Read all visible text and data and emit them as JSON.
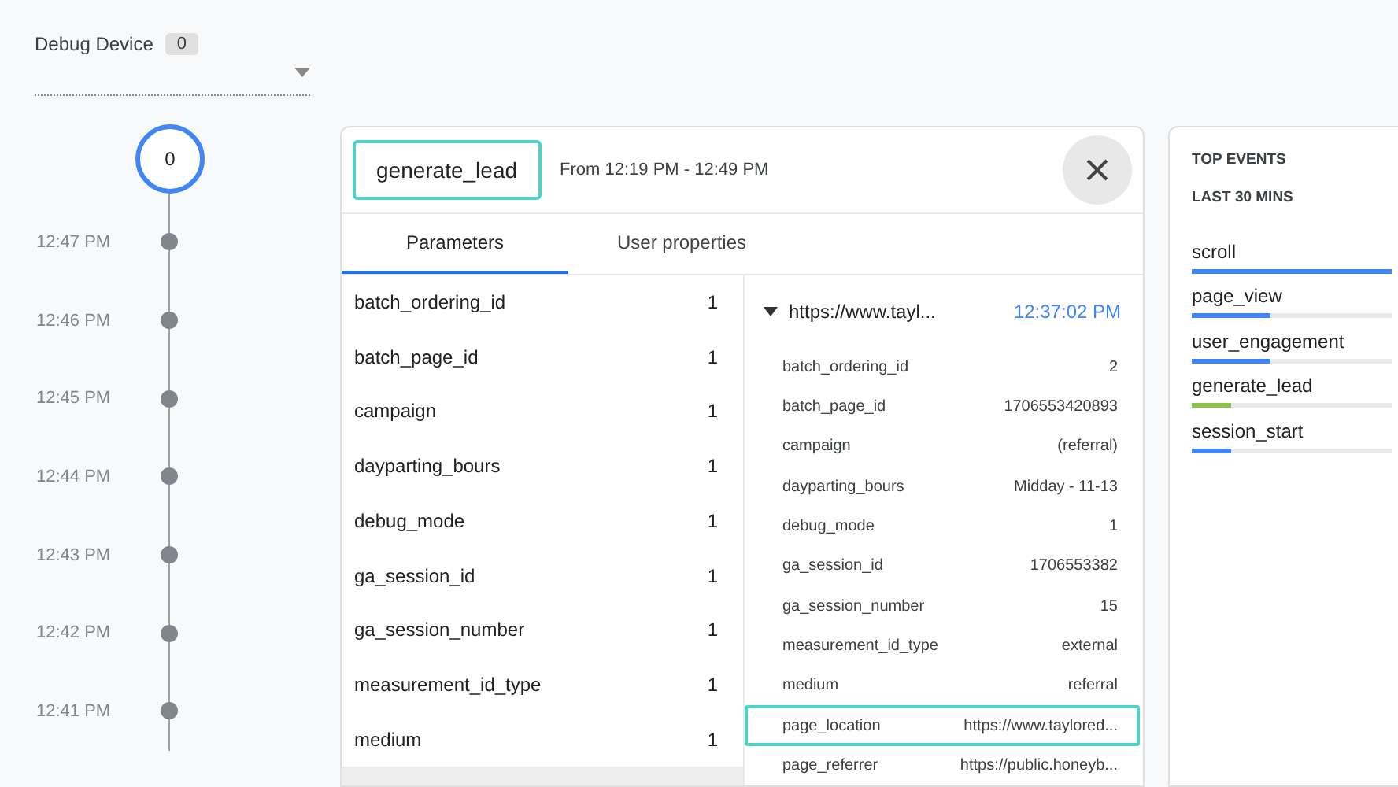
{
  "debug_device": {
    "label": "Debug Device",
    "count": "0"
  },
  "timeline": {
    "event_count": "0",
    "ticks": [
      "12:47 PM",
      "12:46 PM",
      "12:45 PM",
      "12:44 PM",
      "12:43 PM",
      "12:42 PM",
      "12:41 PM"
    ]
  },
  "event_panel": {
    "event_name": "generate_lead",
    "event_highlighted": true,
    "range": "From 12:19 PM - 12:49 PM",
    "tabs": [
      {
        "label": "Parameters",
        "selected": true
      },
      {
        "label": "User properties",
        "selected": false
      }
    ],
    "parameters": [
      {
        "name": "batch_ordering_id",
        "count": "1"
      },
      {
        "name": "batch_page_id",
        "count": "1"
      },
      {
        "name": "campaign",
        "count": "1"
      },
      {
        "name": "dayparting_bours",
        "count": "1"
      },
      {
        "name": "debug_mode",
        "count": "1"
      },
      {
        "name": "ga_session_id",
        "count": "1"
      },
      {
        "name": "ga_session_number",
        "count": "1"
      },
      {
        "name": "measurement_id_type",
        "count": "1"
      },
      {
        "name": "medium",
        "count": "1"
      }
    ],
    "detail": {
      "url": "https://www.tayl...",
      "expanded": true,
      "time": "12:37:02 PM",
      "rows": [
        {
          "key": "batch_ordering_id",
          "value": "2",
          "highlighted": false
        },
        {
          "key": "batch_page_id",
          "value": "1706553420893",
          "highlighted": false
        },
        {
          "key": "campaign",
          "value": "(referral)",
          "highlighted": false
        },
        {
          "key": "dayparting_bours",
          "value": "Midday - 11-13",
          "highlighted": false
        },
        {
          "key": "debug_mode",
          "value": "1",
          "highlighted": false
        },
        {
          "key": "ga_session_id",
          "value": "1706553382",
          "highlighted": false
        },
        {
          "key": "ga_session_number",
          "value": "15",
          "highlighted": false
        },
        {
          "key": "measurement_id_type",
          "value": "external",
          "highlighted": false
        },
        {
          "key": "medium",
          "value": "referral",
          "highlighted": false
        },
        {
          "key": "page_location",
          "value": "https://www.taylored...",
          "highlighted": true
        },
        {
          "key": "page_referrer",
          "value": "https://public.honeyb...",
          "highlighted": false
        }
      ]
    }
  },
  "top_events": {
    "title": "TOP EVENTS",
    "subtitle": "LAST 30 MINS",
    "items": [
      {
        "name": "scroll",
        "level": 1,
        "color": "#4285f4"
      },
      {
        "name": "page_view",
        "level": 0.39,
        "color": "#4285f4"
      },
      {
        "name": "user_engagement",
        "level": 0.39,
        "color": "#4285f4"
      },
      {
        "name": "generate_lead",
        "level": 0.2,
        "color": "#8bc34a"
      },
      {
        "name": "session_start",
        "level": 0.2,
        "color": "#4285f4"
      }
    ]
  }
}
